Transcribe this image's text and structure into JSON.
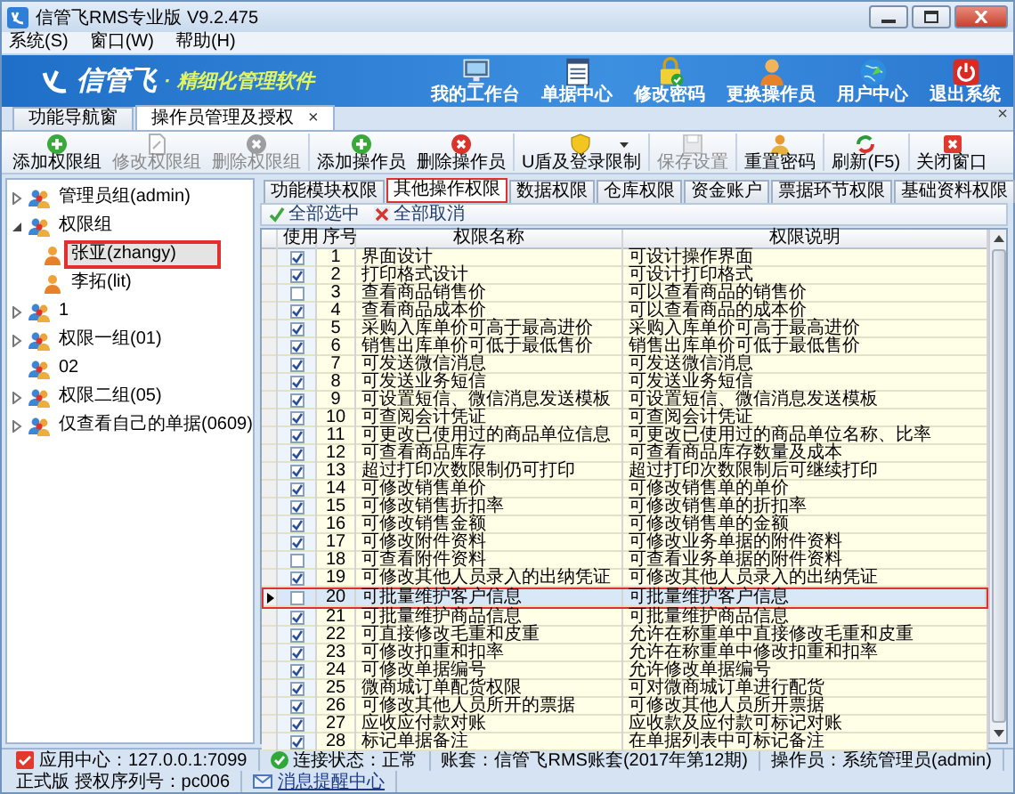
{
  "window": {
    "title": "信管飞RMS专业版 V9.2.475"
  },
  "menu": [
    "系统(S)",
    "窗口(W)",
    "帮助(H)"
  ],
  "banner": {
    "logo": "信管飞",
    "separator": "·",
    "slogan": "精细化管理软件",
    "shortcuts": [
      {
        "label": "我的工作台",
        "kind": "monitor"
      },
      {
        "label": "单据中心",
        "kind": "list"
      },
      {
        "label": "修改密码",
        "kind": "lock"
      },
      {
        "label": "更换操作员",
        "kind": "person"
      },
      {
        "label": "用户中心",
        "kind": "globe"
      },
      {
        "label": "退出系统",
        "kind": "power"
      }
    ]
  },
  "doc_tabs": {
    "tabs": [
      {
        "label": "功能导航窗",
        "selected": false,
        "closable": false
      },
      {
        "label": "操作员管理及授权",
        "selected": true,
        "closable": true
      }
    ],
    "close_mark": "×",
    "close_all": "×"
  },
  "toolbar": [
    [
      {
        "label": "添加权限组",
        "kind": "add",
        "disabled": false,
        "dropdown": false
      },
      {
        "label": "修改权限组",
        "kind": "edit",
        "disabled": true,
        "dropdown": false
      },
      {
        "label": "删除权限组",
        "kind": "delete",
        "disabled": true,
        "dropdown": false
      }
    ],
    [
      {
        "label": "添加操作员",
        "kind": "add",
        "disabled": false,
        "dropdown": false
      },
      {
        "label": "删除操作员",
        "kind": "delete",
        "disabled": false,
        "dropdown": false
      }
    ],
    [
      {
        "label": "U盾及登录限制",
        "kind": "shield",
        "disabled": false,
        "dropdown": true
      }
    ],
    [
      {
        "label": "保存设置",
        "kind": "save",
        "disabled": true,
        "dropdown": false
      }
    ],
    [
      {
        "label": "重置密码",
        "kind": "reset",
        "disabled": false,
        "dropdown": false
      }
    ],
    [
      {
        "label": "刷新(F5)",
        "kind": "refresh",
        "disabled": false,
        "dropdown": false
      }
    ],
    [
      {
        "label": "关闭窗口",
        "kind": "close",
        "disabled": false,
        "dropdown": false
      }
    ]
  ],
  "tree": [
    {
      "label": "管理员组(admin)",
      "expandable": true,
      "expanded": false,
      "selected": false
    },
    {
      "label": "权限组",
      "expandable": true,
      "expanded": true,
      "selected": false,
      "children": [
        {
          "label": "张亚(zhangy)",
          "selected": true
        },
        {
          "label": "李拓(lit)",
          "selected": false
        }
      ]
    },
    {
      "label": "1",
      "expandable": true,
      "expanded": false,
      "selected": false
    },
    {
      "label": "权限一组(01)",
      "expandable": true,
      "expanded": false,
      "selected": false
    },
    {
      "label": "02",
      "expandable": false,
      "selected": false
    },
    {
      "label": "权限二组(05)",
      "expandable": true,
      "expanded": false,
      "selected": false
    },
    {
      "label": "仅查看自己的单据(0609)",
      "expandable": true,
      "expanded": false,
      "selected": false
    }
  ],
  "perm_tabs": [
    {
      "label": "功能模块权限",
      "selected": false
    },
    {
      "label": "其他操作权限",
      "selected": true
    },
    {
      "label": "数据权限",
      "selected": false
    },
    {
      "label": "仓库权限",
      "selected": false
    },
    {
      "label": "资金账户",
      "selected": false
    },
    {
      "label": "票据环节权限",
      "selected": false
    },
    {
      "label": "基础资料权限",
      "selected": false
    }
  ],
  "select_bar": [
    {
      "label": "全部选中",
      "kind": "check"
    },
    {
      "label": "全部取消",
      "kind": "uncheck"
    }
  ],
  "table": {
    "columns": [
      "使用",
      "序号",
      "权限名称",
      "权限说明"
    ],
    "rows": [
      {
        "checked": true,
        "no": "1",
        "name": "界面设计",
        "desc": "可设计操作界面",
        "selected": false
      },
      {
        "checked": true,
        "no": "2",
        "name": "打印格式设计",
        "desc": "可设计打印格式",
        "selected": false
      },
      {
        "checked": false,
        "no": "3",
        "name": "查看商品销售价",
        "desc": "可以查看商品的销售价",
        "selected": false
      },
      {
        "checked": true,
        "no": "4",
        "name": "查看商品成本价",
        "desc": "可以查看商品的成本价",
        "selected": false
      },
      {
        "checked": true,
        "no": "5",
        "name": "采购入库单价可高于最高进价",
        "desc": "采购入库单价可高于最高进价",
        "selected": false
      },
      {
        "checked": true,
        "no": "6",
        "name": "销售出库单价可低于最低售价",
        "desc": "销售出库单价可低于最低售价",
        "selected": false
      },
      {
        "checked": true,
        "no": "7",
        "name": "可发送微信消息",
        "desc": "可发送微信消息",
        "selected": false
      },
      {
        "checked": true,
        "no": "8",
        "name": "可发送业务短信",
        "desc": "可发送业务短信",
        "selected": false
      },
      {
        "checked": true,
        "no": "9",
        "name": "可设置短信、微信消息发送模板",
        "desc": "可设置短信、微信消息发送模板",
        "selected": false
      },
      {
        "checked": true,
        "no": "10",
        "name": "可查阅会计凭证",
        "desc": "可查阅会计凭证",
        "selected": false
      },
      {
        "checked": true,
        "no": "11",
        "name": "可更改已使用过的商品单位信息",
        "desc": "可更改已使用过的商品单位名称、比率",
        "selected": false
      },
      {
        "checked": true,
        "no": "12",
        "name": "可查看商品库存",
        "desc": "可查看商品库存数量及成本",
        "selected": false
      },
      {
        "checked": true,
        "no": "13",
        "name": "超过打印次数限制仍可打印",
        "desc": "超过打印次数限制后可继续打印",
        "selected": false
      },
      {
        "checked": true,
        "no": "14",
        "name": "可修改销售单价",
        "desc": "可修改销售单的单价",
        "selected": false
      },
      {
        "checked": true,
        "no": "15",
        "name": "可修改销售折扣率",
        "desc": "可修改销售单的折扣率",
        "selected": false
      },
      {
        "checked": true,
        "no": "16",
        "name": "可修改销售金额",
        "desc": "可修改销售单的金额",
        "selected": false
      },
      {
        "checked": true,
        "no": "17",
        "name": "可修改附件资料",
        "desc": "可修改业务单据的附件资料",
        "selected": false
      },
      {
        "checked": false,
        "no": "18",
        "name": "可查看附件资料",
        "desc": "可查看业务单据的附件资料",
        "selected": false
      },
      {
        "checked": true,
        "no": "19",
        "name": "可修改其他人员录入的出纳凭证",
        "desc": "可修改其他人员录入的出纳凭证",
        "selected": false
      },
      {
        "checked": false,
        "no": "20",
        "name": "可批量维护客户信息",
        "desc": "可批量维护客户信息",
        "selected": true
      },
      {
        "checked": true,
        "no": "21",
        "name": "可批量维护商品信息",
        "desc": "可批量维护商品信息",
        "selected": false
      },
      {
        "checked": true,
        "no": "22",
        "name": "可直接修改毛重和皮重",
        "desc": "允许在称重单中直接修改毛重和皮重",
        "selected": false
      },
      {
        "checked": true,
        "no": "23",
        "name": "可修改扣重和扣率",
        "desc": "允许在称重单中修改扣重和扣率",
        "selected": false
      },
      {
        "checked": true,
        "no": "24",
        "name": "可修改单据编号",
        "desc": "允许修改单据编号",
        "selected": false
      },
      {
        "checked": true,
        "no": "25",
        "name": "微商城订单配货权限",
        "desc": "可对微商城订单进行配货",
        "selected": false
      },
      {
        "checked": true,
        "no": "26",
        "name": "可修改其他人员所开的票据",
        "desc": "可修改其他人员所开票据",
        "selected": false
      },
      {
        "checked": true,
        "no": "27",
        "name": "应收应付款对账",
        "desc": "应收款及应付款可标记对账",
        "selected": false
      },
      {
        "checked": true,
        "no": "28",
        "name": "标记单据备注",
        "desc": "在单据列表中可标记备注",
        "selected": false
      }
    ]
  },
  "status_bar": [
    {
      "kind": "app",
      "text": "应用中心：127.0.0.1:7099"
    },
    {
      "kind": "connection",
      "text": "连接状态：正常"
    },
    {
      "kind": "plain",
      "text": "账套：信管飞RMS账套(2017年第12期)"
    },
    {
      "kind": "plain",
      "text": "操作员：系统管理员(admin)"
    },
    {
      "kind": "plain",
      "text": "正式版 授权序列号：pc006"
    },
    {
      "kind": "mail",
      "text": "消息提醒中心"
    }
  ]
}
